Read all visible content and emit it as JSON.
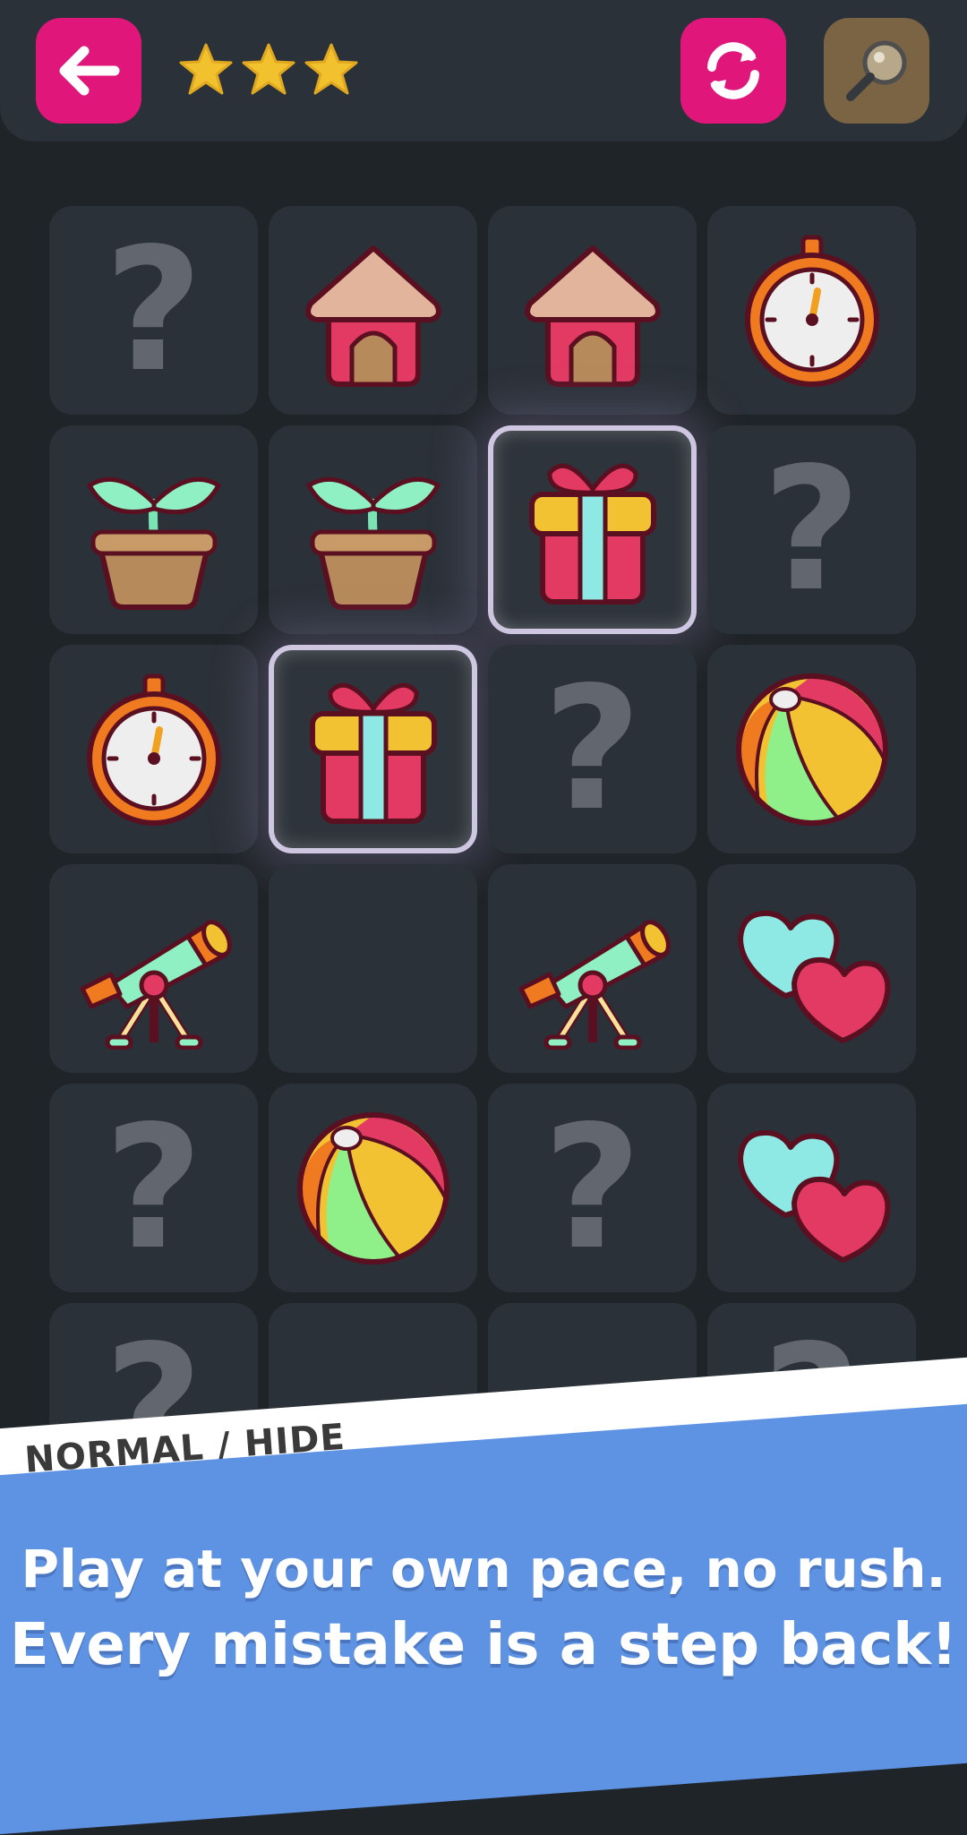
{
  "header": {
    "back_icon": "arrow-left-icon",
    "stars_earned": 3,
    "stars_total": 3,
    "refresh_icon": "refresh-icon",
    "hint_icon": "magnifier-icon",
    "accent_color": "#e0167a",
    "hint_color": "#7a6443",
    "star_color": "#f2c12e"
  },
  "board": {
    "rows": [
      [
        {
          "state": "hidden"
        },
        {
          "state": "revealed",
          "icon": "birdhouse-icon"
        },
        {
          "state": "revealed",
          "icon": "birdhouse-icon"
        },
        {
          "state": "revealed",
          "icon": "stopwatch-icon"
        }
      ],
      [
        {
          "state": "revealed",
          "icon": "sprout-pot-icon"
        },
        {
          "state": "revealed",
          "icon": "sprout-pot-icon"
        },
        {
          "state": "selected",
          "icon": "gift-icon"
        },
        {
          "state": "hidden"
        }
      ],
      [
        {
          "state": "revealed",
          "icon": "stopwatch-icon"
        },
        {
          "state": "selected",
          "icon": "gift-icon"
        },
        {
          "state": "hidden"
        },
        {
          "state": "revealed",
          "icon": "beach-ball-icon"
        }
      ],
      [
        {
          "state": "revealed",
          "icon": "telescope-icon"
        },
        {
          "state": "empty"
        },
        {
          "state": "revealed",
          "icon": "telescope-icon"
        },
        {
          "state": "revealed",
          "icon": "hearts-icon"
        }
      ],
      [
        {
          "state": "hidden"
        },
        {
          "state": "revealed",
          "icon": "beach-ball-icon"
        },
        {
          "state": "hidden"
        },
        {
          "state": "revealed",
          "icon": "hearts-icon"
        }
      ],
      [
        {
          "state": "hidden"
        },
        {
          "state": "empty"
        },
        {
          "state": "empty"
        },
        {
          "state": "hidden"
        }
      ]
    ],
    "hidden_symbol": "?"
  },
  "mode_label": "NORMAL / HIDE",
  "tagline": {
    "line1": "Play at your own pace, no rush.",
    "line2": "Every mistake is a step back!"
  }
}
